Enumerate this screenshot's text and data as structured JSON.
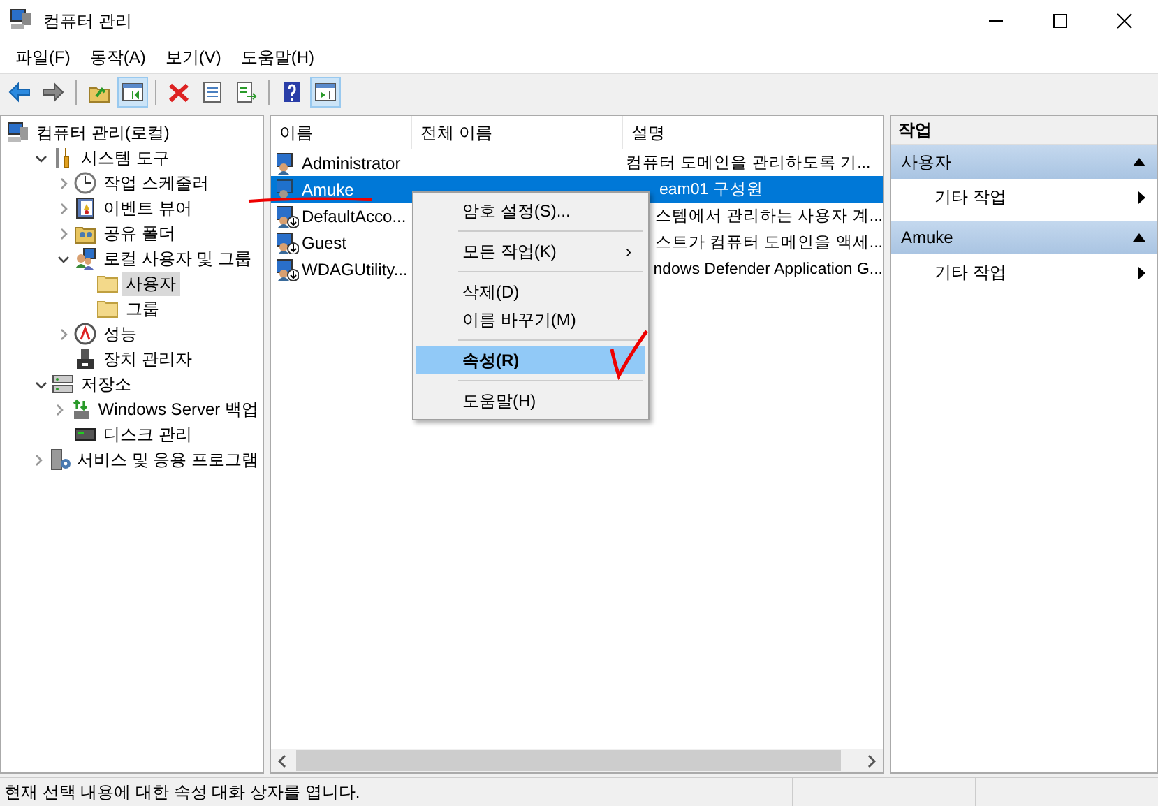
{
  "window": {
    "title": "컴퓨터 관리"
  },
  "menu_bar": [
    "파일(F)",
    "동작(A)",
    "보기(V)",
    "도움말(H)"
  ],
  "toolbar": [
    [
      {
        "kind": "back",
        "pressed": false
      },
      {
        "kind": "forward",
        "pressed": false
      }
    ],
    [
      {
        "kind": "up",
        "pressed": false
      },
      {
        "kind": "tree",
        "pressed": true
      }
    ],
    [
      {
        "kind": "delete",
        "pressed": false
      },
      {
        "kind": "properties",
        "pressed": false
      },
      {
        "kind": "export",
        "pressed": false
      }
    ],
    [
      {
        "kind": "help",
        "pressed": false
      },
      {
        "kind": "actions",
        "pressed": true
      }
    ]
  ],
  "tree": [
    {
      "label": "컴퓨터 관리(로컬)",
      "kind": "computer",
      "selected": false,
      "children": [
        {
          "label": "시스템 도구",
          "kind": "tools",
          "selected": false,
          "expanded": true,
          "children": [
            {
              "label": "작업 스케줄러",
              "kind": "clock",
              "selected": false,
              "expanded": false
            },
            {
              "label": "이벤트 뷰어",
              "kind": "log",
              "selected": false,
              "expanded": false
            },
            {
              "label": "공유 폴더",
              "kind": "share",
              "selected": false,
              "expanded": false
            },
            {
              "label": "로컬 사용자 및 그룹",
              "kind": "users",
              "selected": false,
              "expanded": true,
              "children": [
                {
                  "label": "사용자",
                  "kind": "folder",
                  "selected": true
                },
                {
                  "label": "그룹",
                  "kind": "folder",
                  "selected": false
                }
              ]
            },
            {
              "label": "성능",
              "kind": "gauge",
              "selected": false,
              "expanded": false
            },
            {
              "label": "장치 관리자",
              "kind": "device",
              "selected": false
            }
          ]
        },
        {
          "label": "저장소",
          "kind": "storage",
          "selected": false,
          "expanded": true,
          "children": [
            {
              "label": "Windows Server 백업",
              "kind": "backup",
              "selected": false,
              "expanded": false
            },
            {
              "label": "디스크 관리",
              "kind": "disk",
              "selected": false
            }
          ]
        },
        {
          "label": "서비스 및 응용 프로그램",
          "kind": "services",
          "selected": false,
          "expanded": false
        }
      ]
    }
  ],
  "table": {
    "columns": [
      "이름",
      "전체 이름",
      "설명"
    ],
    "rows": [
      {
        "name": "Administrator",
        "description": "컴퓨터 도메인을 관리하도록 기...",
        "selected": false,
        "disabled": false,
        "covered": false
      },
      {
        "name": "Amuke",
        "description": "eam01 구성원",
        "selected": true,
        "disabled": false,
        "covered": true
      },
      {
        "name": "DefaultAcco...",
        "description": "스템에서 관리하는 사용자 계...",
        "selected": false,
        "disabled": true,
        "covered": true
      },
      {
        "name": "Guest",
        "description": "스트가 컴퓨터 도메인을 액세...",
        "selected": false,
        "disabled": true,
        "covered": true
      },
      {
        "name": "WDAGUtility...",
        "description": "ndows Defender Application G...",
        "selected": false,
        "disabled": true,
        "covered": true
      }
    ]
  },
  "context_menu": [
    [
      {
        "label": "암호 설정(S)...",
        "selected": false,
        "default": false
      }
    ],
    [
      {
        "label": "모든 작업(K)",
        "selected": false,
        "default": false,
        "submenu": "›"
      }
    ],
    [
      {
        "label": "삭제(D)",
        "selected": false,
        "default": false
      },
      {
        "label": "이름 바꾸기(M)",
        "selected": false,
        "default": false
      }
    ],
    [
      {
        "label": "속성(R)",
        "selected": true,
        "default": true
      }
    ],
    [
      {
        "label": "도움말(H)",
        "selected": false,
        "default": false
      }
    ]
  ],
  "actions": {
    "title": "작업",
    "sections": [
      {
        "title": "사용자",
        "expanded": true,
        "items": [
          "기타 작업"
        ]
      },
      {
        "title": "Amuke",
        "expanded": true,
        "items": [
          "기타 작업"
        ]
      }
    ]
  },
  "status_bar": "현재 선택 내용에 대한 속성 대화 상자를 엽니다."
}
